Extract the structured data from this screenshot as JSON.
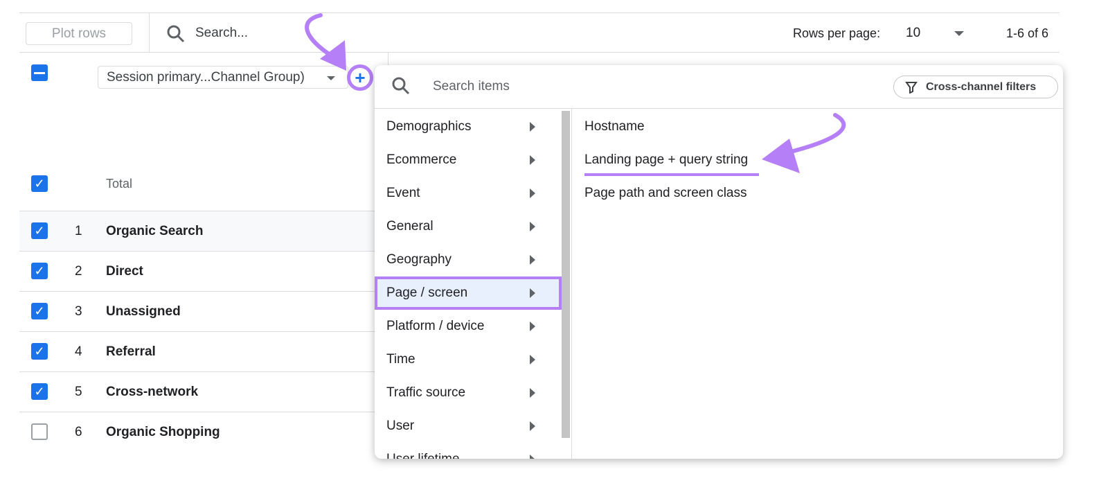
{
  "toolbar": {
    "plot_rows": "Plot rows",
    "search_placeholder": "Search...",
    "rows_per_page_label": "Rows per page:",
    "rows_per_page_value": "10",
    "pagination": "1-6 of 6"
  },
  "dimension_select": {
    "value": "Session primary...Channel Group)"
  },
  "total_label": "Total",
  "rows": [
    {
      "num": "1",
      "label": "Organic Search",
      "checked": true
    },
    {
      "num": "2",
      "label": "Direct",
      "checked": true
    },
    {
      "num": "3",
      "label": "Unassigned",
      "checked": true
    },
    {
      "num": "4",
      "label": "Referral",
      "checked": true
    },
    {
      "num": "5",
      "label": "Cross-network",
      "checked": true
    },
    {
      "num": "6",
      "label": "Organic Shopping",
      "checked": false
    }
  ],
  "popup": {
    "search_placeholder": "Search items",
    "cross_channel": "Cross-channel filters",
    "categories": [
      "Demographics",
      "Ecommerce",
      "Event",
      "General",
      "Geography",
      "Page / screen",
      "Platform / device",
      "Time",
      "Traffic source",
      "User",
      "User lifetime"
    ],
    "selected_category": "Page / screen",
    "items": [
      "Hostname",
      "Landing page + query string",
      "Page path and screen class"
    ]
  },
  "colors": {
    "accent": "#1a73e8",
    "annotation": "#b57ff7",
    "selected_bg": "#e8f0fe"
  }
}
